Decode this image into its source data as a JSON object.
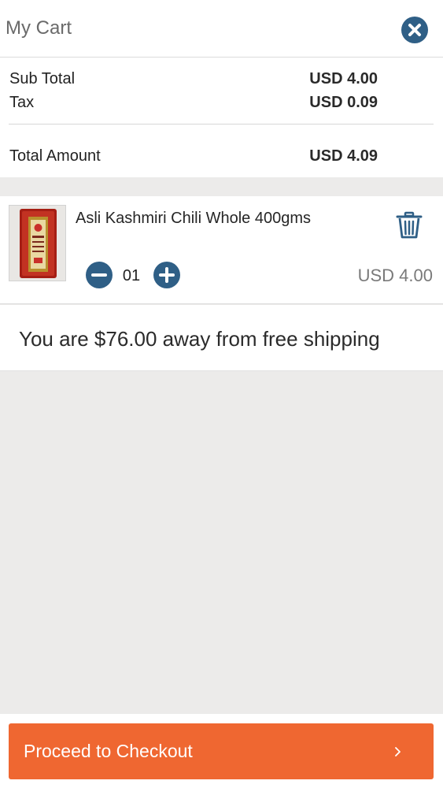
{
  "header": {
    "title": "My Cart"
  },
  "summary": {
    "subtotal_label": "Sub Total",
    "subtotal_value": "USD 4.00",
    "tax_label": "Tax",
    "tax_value": "USD 0.09",
    "total_label": "Total Amount",
    "total_value": "USD 4.09"
  },
  "item": {
    "name": "Asli Kashmiri Chili Whole 400gms",
    "quantity": "01",
    "price": "USD 4.00"
  },
  "shipping": {
    "message": "You are $76.00 away from free shipping"
  },
  "footer": {
    "checkout_label": "Proceed to Checkout"
  },
  "colors": {
    "accent": "#2f5f86",
    "checkout": "#ef6731",
    "background": "#ecebea"
  },
  "icons": [
    "close-icon",
    "trash-icon",
    "minus-icon",
    "plus-icon",
    "chevron-right-icon"
  ]
}
